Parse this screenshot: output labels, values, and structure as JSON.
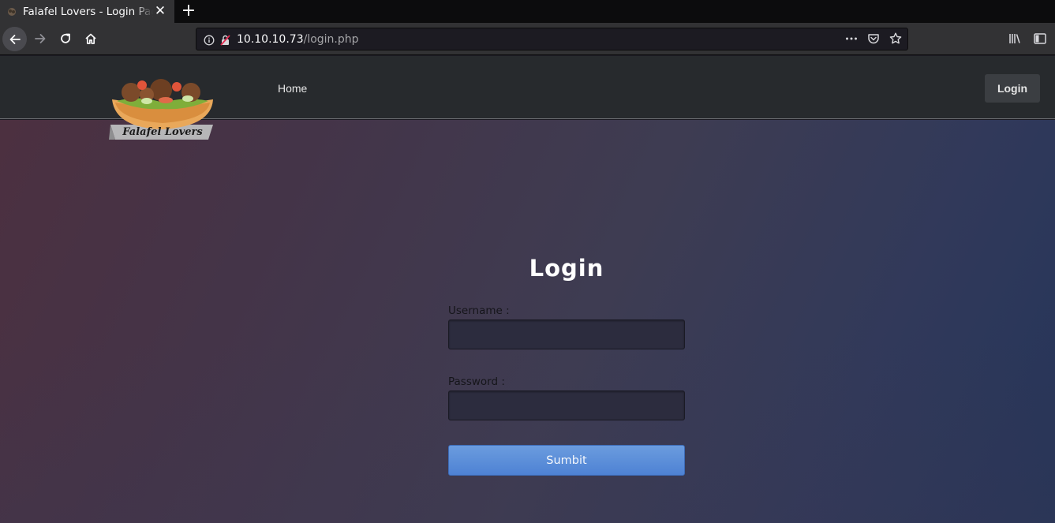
{
  "browser": {
    "tab_title": "Falafel Lovers - Login Page",
    "url_host": "10.10.10.73",
    "url_path": "/login.php"
  },
  "site": {
    "brand": "Falafel Lovers",
    "nav": {
      "home": "Home",
      "login": "Login"
    }
  },
  "login_form": {
    "title": "Login",
    "username_label": "Username :",
    "password_label": "Password :",
    "submit_label": "Sumbit"
  },
  "colors": {
    "header_bg": "#272a2d",
    "button_blue": "#5a8cd8",
    "input_bg": "#2c2c3e"
  }
}
